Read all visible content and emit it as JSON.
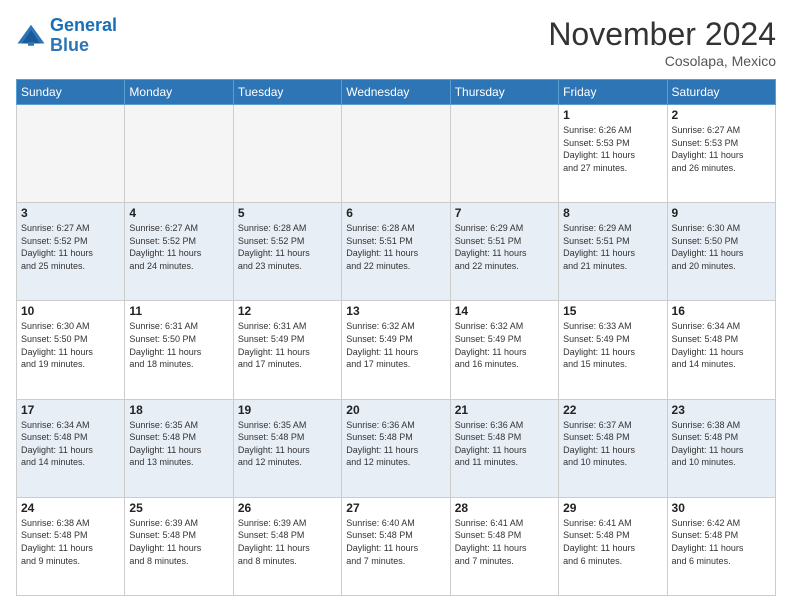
{
  "logo": {
    "line1": "General",
    "line2": "Blue"
  },
  "title": "November 2024",
  "location": "Cosolapa, Mexico",
  "days_header": [
    "Sunday",
    "Monday",
    "Tuesday",
    "Wednesday",
    "Thursday",
    "Friday",
    "Saturday"
  ],
  "weeks": [
    {
      "shaded": false,
      "days": [
        {
          "num": "",
          "info": ""
        },
        {
          "num": "",
          "info": ""
        },
        {
          "num": "",
          "info": ""
        },
        {
          "num": "",
          "info": ""
        },
        {
          "num": "",
          "info": ""
        },
        {
          "num": "1",
          "info": "Sunrise: 6:26 AM\nSunset: 5:53 PM\nDaylight: 11 hours\nand 27 minutes."
        },
        {
          "num": "2",
          "info": "Sunrise: 6:27 AM\nSunset: 5:53 PM\nDaylight: 11 hours\nand 26 minutes."
        }
      ]
    },
    {
      "shaded": true,
      "days": [
        {
          "num": "3",
          "info": "Sunrise: 6:27 AM\nSunset: 5:52 PM\nDaylight: 11 hours\nand 25 minutes."
        },
        {
          "num": "4",
          "info": "Sunrise: 6:27 AM\nSunset: 5:52 PM\nDaylight: 11 hours\nand 24 minutes."
        },
        {
          "num": "5",
          "info": "Sunrise: 6:28 AM\nSunset: 5:52 PM\nDaylight: 11 hours\nand 23 minutes."
        },
        {
          "num": "6",
          "info": "Sunrise: 6:28 AM\nSunset: 5:51 PM\nDaylight: 11 hours\nand 22 minutes."
        },
        {
          "num": "7",
          "info": "Sunrise: 6:29 AM\nSunset: 5:51 PM\nDaylight: 11 hours\nand 22 minutes."
        },
        {
          "num": "8",
          "info": "Sunrise: 6:29 AM\nSunset: 5:51 PM\nDaylight: 11 hours\nand 21 minutes."
        },
        {
          "num": "9",
          "info": "Sunrise: 6:30 AM\nSunset: 5:50 PM\nDaylight: 11 hours\nand 20 minutes."
        }
      ]
    },
    {
      "shaded": false,
      "days": [
        {
          "num": "10",
          "info": "Sunrise: 6:30 AM\nSunset: 5:50 PM\nDaylight: 11 hours\nand 19 minutes."
        },
        {
          "num": "11",
          "info": "Sunrise: 6:31 AM\nSunset: 5:50 PM\nDaylight: 11 hours\nand 18 minutes."
        },
        {
          "num": "12",
          "info": "Sunrise: 6:31 AM\nSunset: 5:49 PM\nDaylight: 11 hours\nand 17 minutes."
        },
        {
          "num": "13",
          "info": "Sunrise: 6:32 AM\nSunset: 5:49 PM\nDaylight: 11 hours\nand 17 minutes."
        },
        {
          "num": "14",
          "info": "Sunrise: 6:32 AM\nSunset: 5:49 PM\nDaylight: 11 hours\nand 16 minutes."
        },
        {
          "num": "15",
          "info": "Sunrise: 6:33 AM\nSunset: 5:49 PM\nDaylight: 11 hours\nand 15 minutes."
        },
        {
          "num": "16",
          "info": "Sunrise: 6:34 AM\nSunset: 5:48 PM\nDaylight: 11 hours\nand 14 minutes."
        }
      ]
    },
    {
      "shaded": true,
      "days": [
        {
          "num": "17",
          "info": "Sunrise: 6:34 AM\nSunset: 5:48 PM\nDaylight: 11 hours\nand 14 minutes."
        },
        {
          "num": "18",
          "info": "Sunrise: 6:35 AM\nSunset: 5:48 PM\nDaylight: 11 hours\nand 13 minutes."
        },
        {
          "num": "19",
          "info": "Sunrise: 6:35 AM\nSunset: 5:48 PM\nDaylight: 11 hours\nand 12 minutes."
        },
        {
          "num": "20",
          "info": "Sunrise: 6:36 AM\nSunset: 5:48 PM\nDaylight: 11 hours\nand 12 minutes."
        },
        {
          "num": "21",
          "info": "Sunrise: 6:36 AM\nSunset: 5:48 PM\nDaylight: 11 hours\nand 11 minutes."
        },
        {
          "num": "22",
          "info": "Sunrise: 6:37 AM\nSunset: 5:48 PM\nDaylight: 11 hours\nand 10 minutes."
        },
        {
          "num": "23",
          "info": "Sunrise: 6:38 AM\nSunset: 5:48 PM\nDaylight: 11 hours\nand 10 minutes."
        }
      ]
    },
    {
      "shaded": false,
      "days": [
        {
          "num": "24",
          "info": "Sunrise: 6:38 AM\nSunset: 5:48 PM\nDaylight: 11 hours\nand 9 minutes."
        },
        {
          "num": "25",
          "info": "Sunrise: 6:39 AM\nSunset: 5:48 PM\nDaylight: 11 hours\nand 8 minutes."
        },
        {
          "num": "26",
          "info": "Sunrise: 6:39 AM\nSunset: 5:48 PM\nDaylight: 11 hours\nand 8 minutes."
        },
        {
          "num": "27",
          "info": "Sunrise: 6:40 AM\nSunset: 5:48 PM\nDaylight: 11 hours\nand 7 minutes."
        },
        {
          "num": "28",
          "info": "Sunrise: 6:41 AM\nSunset: 5:48 PM\nDaylight: 11 hours\nand 7 minutes."
        },
        {
          "num": "29",
          "info": "Sunrise: 6:41 AM\nSunset: 5:48 PM\nDaylight: 11 hours\nand 6 minutes."
        },
        {
          "num": "30",
          "info": "Sunrise: 6:42 AM\nSunset: 5:48 PM\nDaylight: 11 hours\nand 6 minutes."
        }
      ]
    }
  ]
}
